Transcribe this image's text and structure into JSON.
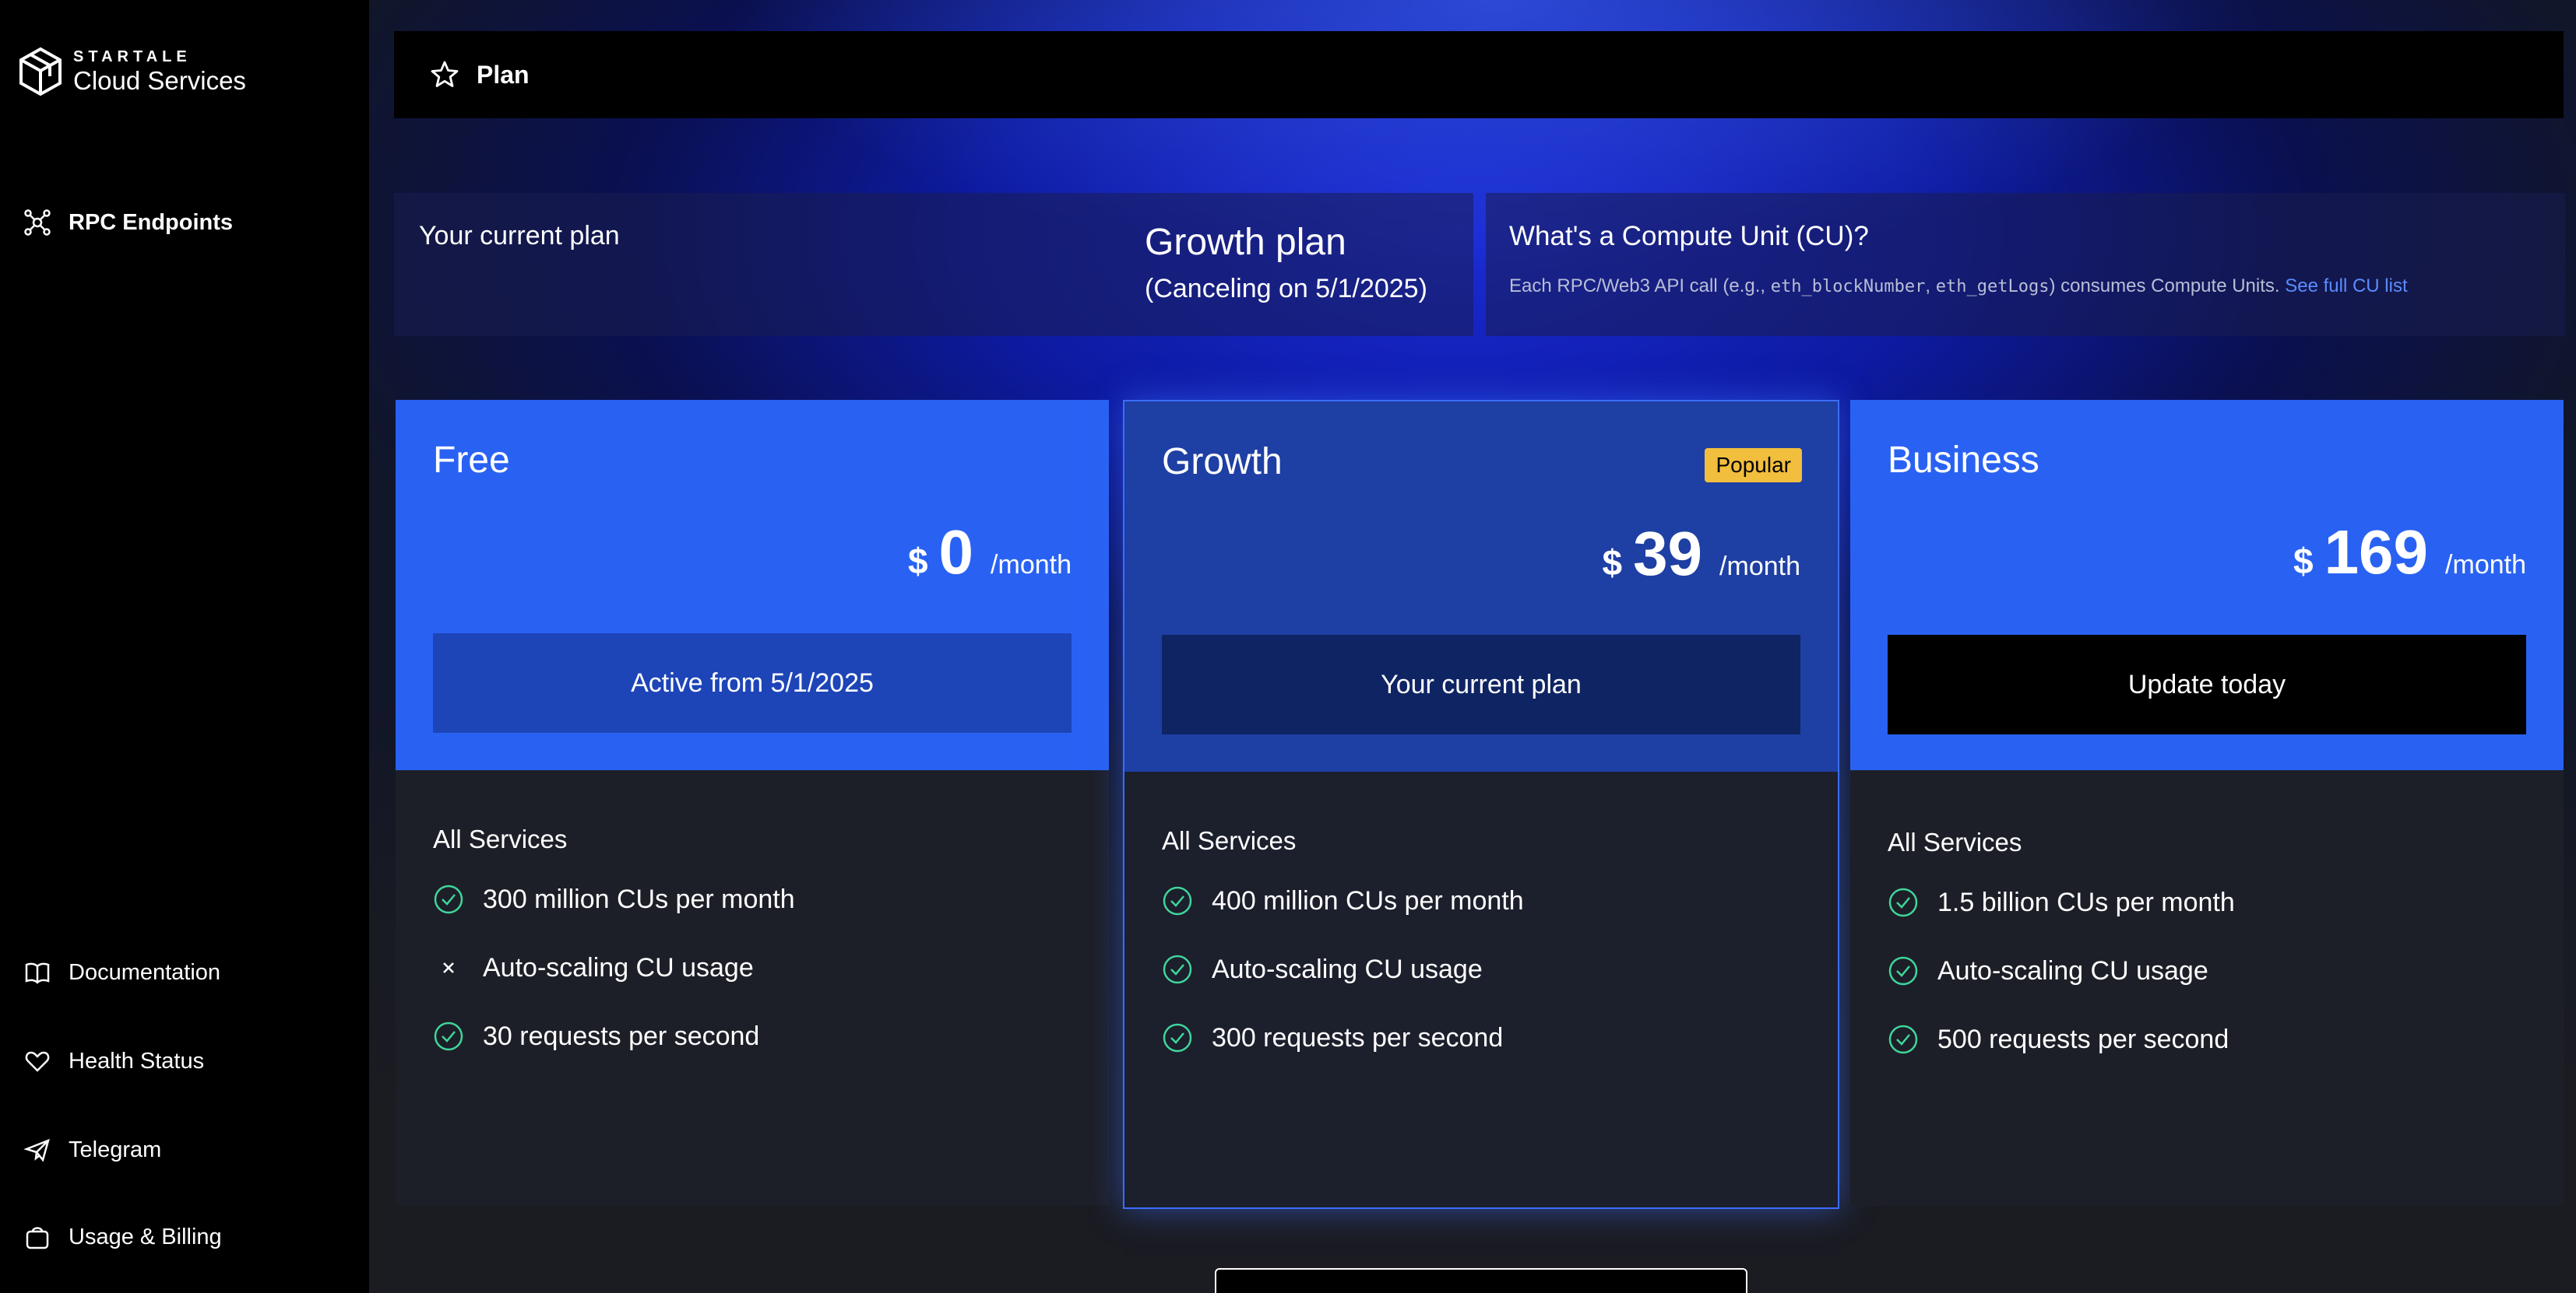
{
  "sidebar": {
    "logo_top": "STARTALE",
    "logo_bottom": "Cloud Services",
    "items": [
      {
        "label": "RPC Endpoints",
        "icon": "network-icon"
      },
      {
        "label": "Documentation",
        "icon": "book-icon"
      },
      {
        "label": "Health Status",
        "icon": "heart-icon"
      },
      {
        "label": "Telegram",
        "icon": "send-icon"
      },
      {
        "label": "Usage & Billing",
        "icon": "bag-icon"
      }
    ]
  },
  "header": {
    "title": "Plan",
    "icon": "star-icon"
  },
  "current": {
    "label": "Your current plan",
    "plan": "Growth plan",
    "status": "(Canceling on 5/1/2025)"
  },
  "cu_info": {
    "title": "What's a Compute Unit (CU)?",
    "desc_pre": "Each RPC/Web3 API call (e.g., ",
    "code1": "eth_blockNumber",
    "sep": ", ",
    "code2": "eth_getLogs",
    "desc_post": ") consumes Compute Units.",
    "link": "See full CU list"
  },
  "plans": [
    {
      "name": "Free",
      "currency": "$",
      "amount": "0",
      "period": "/month",
      "cta": "Active from 5/1/2025",
      "features_title": "All Services",
      "features": [
        {
          "text": "300 million CUs per month",
          "included": true
        },
        {
          "text": "Auto-scaling CU usage",
          "included": false
        },
        {
          "text": "30 requests per second",
          "included": true
        }
      ]
    },
    {
      "name": "Growth",
      "badge": "Popular",
      "currency": "$",
      "amount": "39",
      "period": "/month",
      "cta": "Your current plan",
      "features_title": "All Services",
      "features": [
        {
          "text": "400 million CUs per month",
          "included": true
        },
        {
          "text": "Auto-scaling CU usage",
          "included": true
        },
        {
          "text": "300 requests per second",
          "included": true
        }
      ]
    },
    {
      "name": "Business",
      "currency": "$",
      "amount": "169",
      "period": "/month",
      "cta": "Update today",
      "features_title": "All Services",
      "features": [
        {
          "text": "1.5 billion CUs per month",
          "included": true
        },
        {
          "text": "Auto-scaling CU usage",
          "included": true
        },
        {
          "text": "500 requests per second",
          "included": true
        }
      ]
    }
  ],
  "colors": {
    "accent": "#2962f3",
    "growth_card": "#1e3fa3",
    "badge": "#f2be3d",
    "check": "#3fd69b",
    "link": "#5b8cff"
  }
}
